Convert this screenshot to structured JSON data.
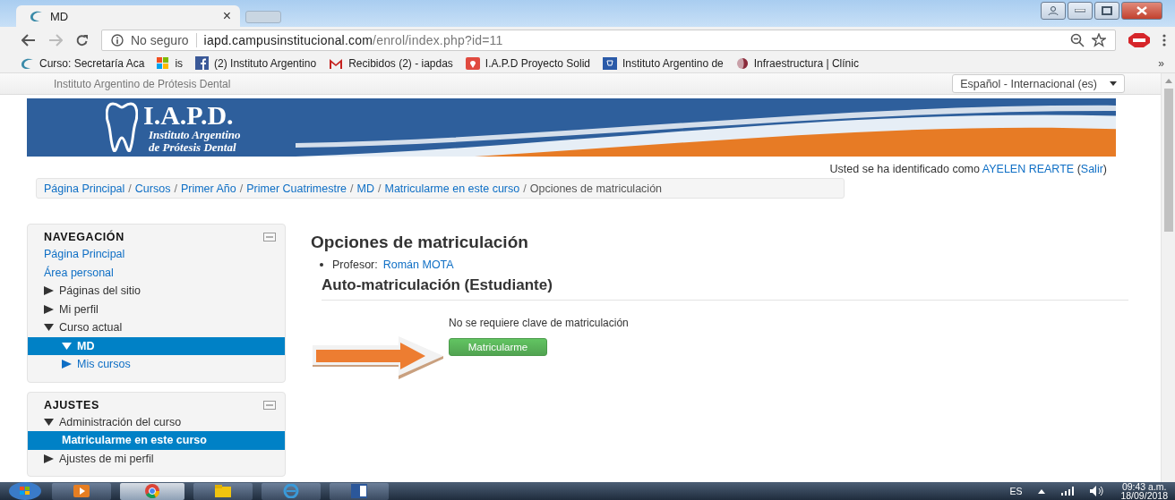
{
  "browser": {
    "tab": {
      "title": "MD",
      "close": "×"
    },
    "address": {
      "security": "No seguro",
      "host": "iapd.campusinstitucional.com",
      "path": "/enrol/index.php?id=11"
    },
    "bookmarks": [
      {
        "label": "Curso: Secretaría Aca",
        "kind": "swirl"
      },
      {
        "label": "is",
        "kind": "windows"
      },
      {
        "label": "(2) Instituto Argentino",
        "kind": "facebook"
      },
      {
        "label": "Recibidos (2) - iapdas",
        "kind": "gmail"
      },
      {
        "label": "I.A.P.D Proyecto Solid",
        "kind": "pin"
      },
      {
        "label": "Instituto Argentino de",
        "kind": "blue"
      },
      {
        "label": "Infraestructura | Clínic",
        "kind": "globe"
      }
    ],
    "more": "»"
  },
  "site": {
    "name": "Instituto Argentino de Prótesis Dental",
    "language": "Español - Internacional (es)",
    "logo": {
      "mark": "I.A.P.D.",
      "line1": "Instituto Argentino",
      "line2": "de Prótesis Dental"
    },
    "login": {
      "prefix": "Usted se ha identificado como",
      "user": "AYELEN REARTE",
      "logout_open": "(",
      "logout": "Salir",
      "logout_close": ")"
    }
  },
  "breadcrumb": [
    {
      "label": "Página Principal",
      "link": true,
      "sep": "/"
    },
    {
      "label": "Cursos",
      "link": true,
      "sep": "/"
    },
    {
      "label": "Primer Año",
      "link": true,
      "sep": "/"
    },
    {
      "label": "Primer Cuatrimestre",
      "link": true,
      "sep": "/"
    },
    {
      "label": "MD",
      "link": true,
      "sep": "/"
    },
    {
      "label": "Matricularme en este curso",
      "link": true,
      "sep": "/"
    },
    {
      "label": "Opciones de matriculación",
      "link": false
    }
  ],
  "blocks": [
    {
      "title": "NAVEGACIÓN",
      "items": [
        {
          "label": "Página Principal",
          "link": true
        },
        {
          "label": "Área personal",
          "link": true
        },
        {
          "label": "Páginas del sitio",
          "expanded": false
        },
        {
          "label": "Mi perfil",
          "expanded": false
        },
        {
          "label": "Curso actual",
          "expanded": true,
          "children": [
            {
              "label": "MD",
              "expanded": true,
              "selected": true
            },
            {
              "label": "Mis cursos",
              "expanded": false,
              "link": true
            }
          ]
        }
      ]
    },
    {
      "title": "AJUSTES",
      "items": [
        {
          "label": "Administración del curso",
          "expanded": true,
          "children": [
            {
              "label": "Matricularme en este curso",
              "selected": true
            }
          ]
        },
        {
          "label": "Ajustes de mi perfil",
          "expanded": false
        }
      ]
    }
  ],
  "main": {
    "title": "Opciones de matriculación",
    "teacher_label": "Profesor:",
    "teacher": "Román MOTA",
    "section": "Auto-matriculación (Estudiante)",
    "note": "No se requiere clave de matriculación",
    "button": "Matricularme"
  },
  "taskbar": {
    "language": "ES",
    "time": "09:43 a.m.",
    "date": "18/09/2018"
  }
}
